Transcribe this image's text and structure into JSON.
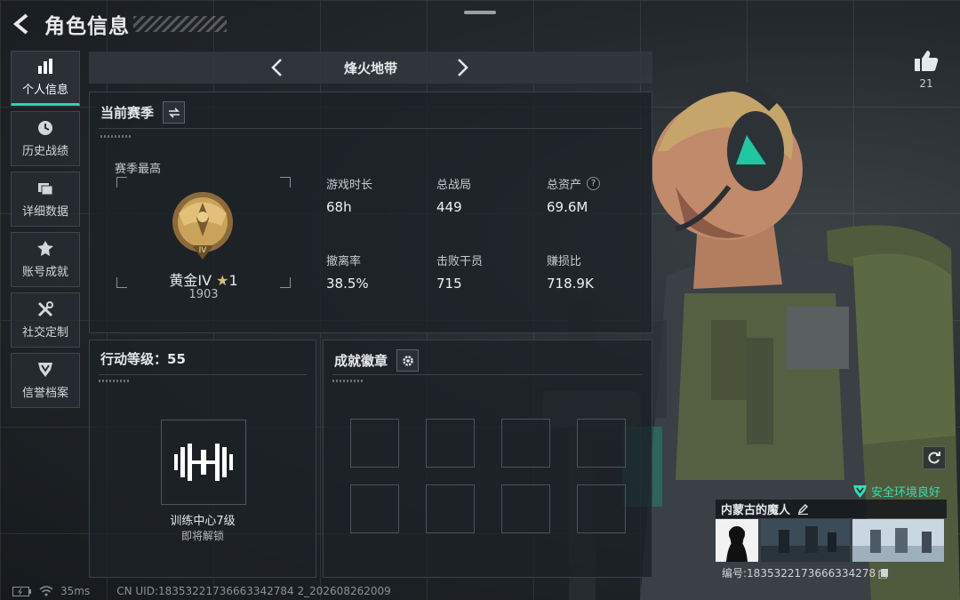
{
  "header": {
    "title": "角色信息",
    "like_count": "21"
  },
  "sidebar": {
    "items": [
      {
        "label": "个人信息",
        "icon": "bar-chart-icon",
        "active": true
      },
      {
        "label": "历史战绩",
        "icon": "clock-icon"
      },
      {
        "label": "详细数据",
        "icon": "folder-icon"
      },
      {
        "label": "账号成就",
        "icon": "medal-icon"
      },
      {
        "label": "社交定制",
        "icon": "tools-icon"
      },
      {
        "label": "信誉档案",
        "icon": "shield-icon"
      }
    ]
  },
  "mode": {
    "label": "烽火地带"
  },
  "season": {
    "title": "当前赛季",
    "best_label": "赛季最高",
    "rank_name": "黄金IV",
    "rank_star": "1",
    "rank_score": "1903",
    "rank_badge_text": "IV",
    "stats": [
      {
        "label": "游戏时长",
        "value": "68h"
      },
      {
        "label": "总战局",
        "value": "449"
      },
      {
        "label": "总资产",
        "value": "69.6M",
        "help": "?"
      },
      {
        "label": "撤离率",
        "value": "38.5%"
      },
      {
        "label": "击败干员",
        "value": "715"
      },
      {
        "label": "赚损比",
        "value": "718.9K"
      }
    ]
  },
  "level": {
    "title": "行动等级：55",
    "unlock_name": "训练中心7级",
    "unlock_status": "即将解锁"
  },
  "badges": {
    "title": "成就徽章",
    "slots": 8
  },
  "player": {
    "safety": "安全环境良好",
    "name": "内蒙古的魔人",
    "id_text": "编号:1835322173666334278"
  },
  "footer": {
    "ping": "35ms",
    "uid": "CN UID:18353221736663342784 2_202608262009"
  },
  "colors": {
    "accent": "#28d8b0",
    "gold": "#c9a35a"
  }
}
